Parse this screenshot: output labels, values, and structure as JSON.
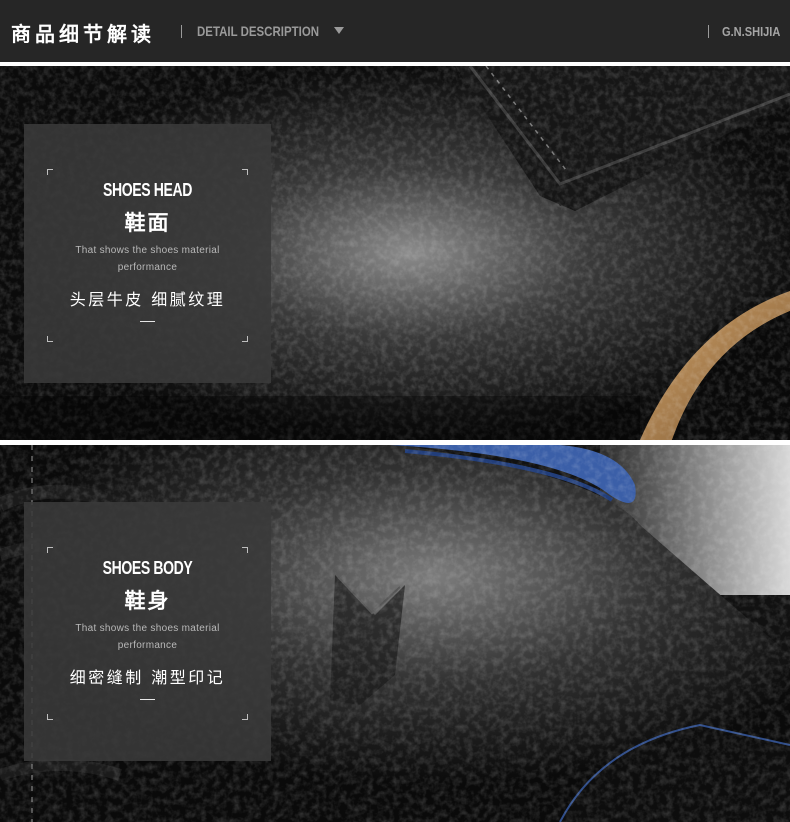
{
  "header": {
    "title_cn": "商品细节解读",
    "title_en": "DETAIL DESCRIPTION",
    "brand": "G.N.SHIJIA"
  },
  "sections": [
    {
      "title_en": "SHOES HEAD",
      "title_cn": "鞋面",
      "description": "That shows the shoes material performance",
      "tagline": "头层牛皮 细腻纹理"
    },
    {
      "title_en": "SHOES BODY",
      "title_cn": "鞋身",
      "description": "That shows the shoes material performance",
      "tagline": "细密缝制 潮型印记"
    }
  ],
  "colors": {
    "header_bg": "#262626",
    "overlay_bg": "#3a3a3a",
    "accent_tan": "#b08552",
    "accent_blue": "#3b5fa8"
  }
}
